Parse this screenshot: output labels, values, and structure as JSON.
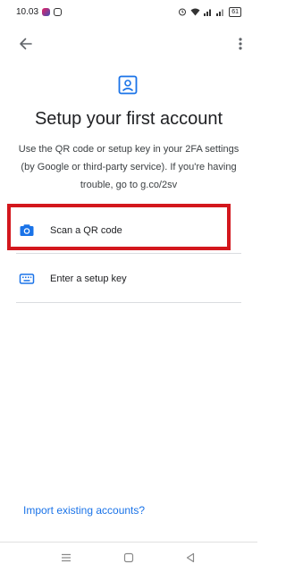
{
  "status_bar": {
    "time": "10.03",
    "battery": "61"
  },
  "app_bar": {
    "back_icon": "arrow-back-icon",
    "more_icon": "more-vert-icon"
  },
  "header": {
    "icon": "account-box-icon",
    "title": "Setup your first account",
    "description": "Use the QR code or setup key in your 2FA settings (by Google or third-party service). If you're having trouble, go to g.co/2sv"
  },
  "options": [
    {
      "label": "Scan a QR code",
      "icon": "camera-icon",
      "highlighted": true
    },
    {
      "label": "Enter a setup key",
      "icon": "keyboard-icon",
      "highlighted": false
    }
  ],
  "import_link": "Import existing accounts?",
  "colors": {
    "accent": "#1a73e8",
    "highlight_border": "#d3171d",
    "title_text": "#202124",
    "divider": "#dadce0"
  },
  "nav_bar": {
    "icons": [
      "menu-icon",
      "home-icon",
      "back-icon"
    ]
  }
}
